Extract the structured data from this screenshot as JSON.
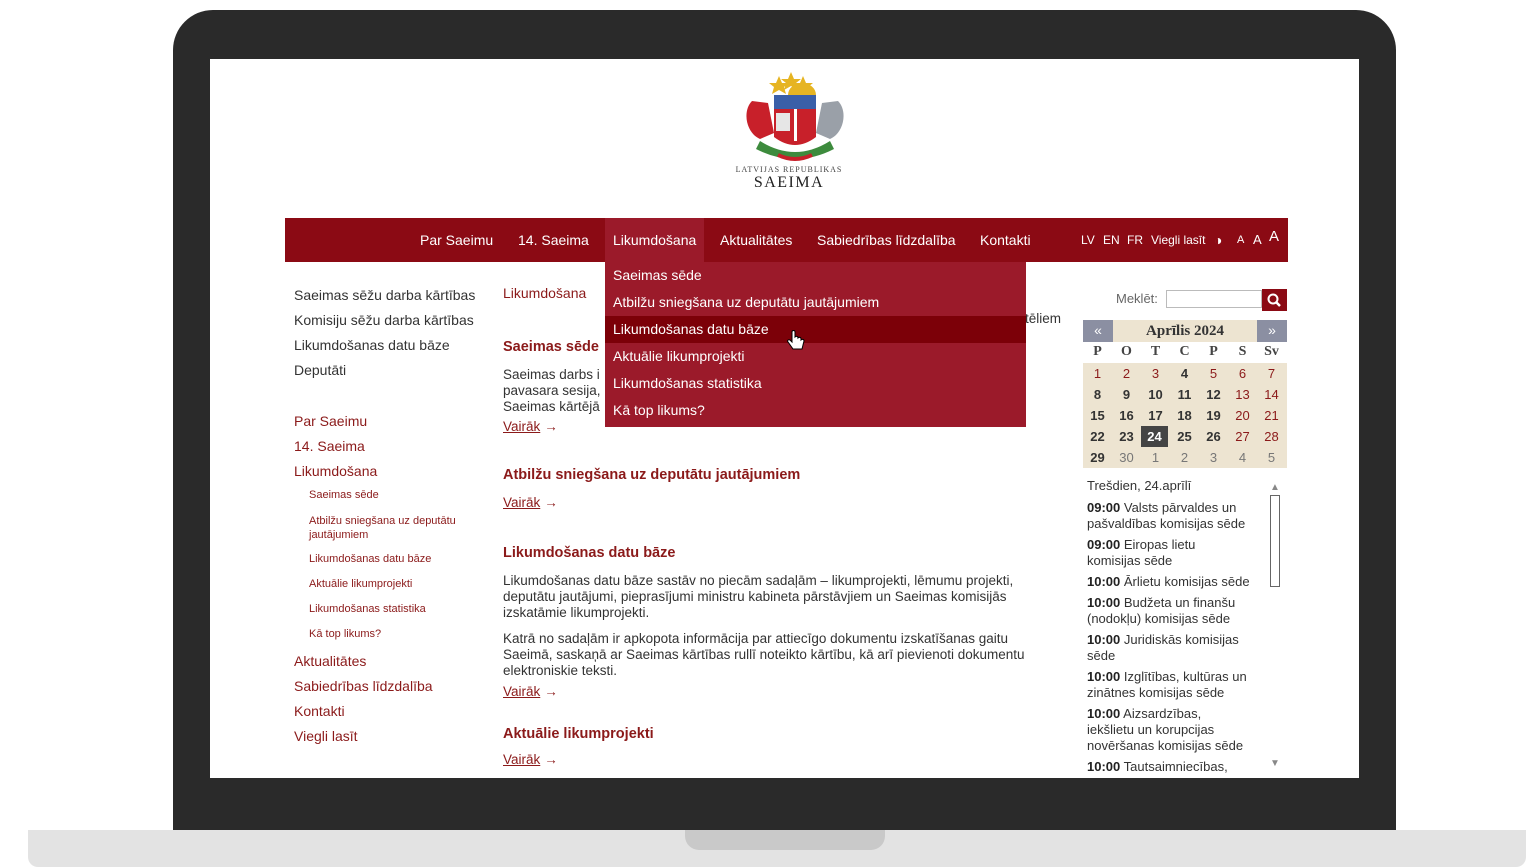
{
  "logo": {
    "line1": "LATVIJAS REPUBLIKAS",
    "line2": "SAEIMA"
  },
  "nav": {
    "items": [
      "Par Saeimu",
      "14. Saeima",
      "Likumdošana",
      "Aktualitātes",
      "Sabiedrības līdzdalība",
      "Kontakti"
    ],
    "active": "Likumdošana",
    "utils": [
      "LV",
      "EN",
      "FR",
      "Viegli lasīt"
    ],
    "font_sizes": [
      "A",
      "A",
      "A"
    ]
  },
  "dropdown": {
    "items": [
      "Saeimas sēde",
      "Atbilžu sniegšana uz deputātu jautājumiem",
      "Likumdošanas datu bāze",
      "Aktuālie likumprojekti",
      "Likumdošanas statistika",
      "Kā top likums?"
    ],
    "hovered": "Likumdošanas datu bāze"
  },
  "sidebar": {
    "quick": [
      "Saeimas sēžu darba kārtības",
      "Komisiju sēžu darba kārtības",
      "Likumdošanas datu bāze",
      "Deputāti"
    ],
    "menu": [
      "Par Saeimu",
      "14. Saeima",
      "Likumdošana"
    ],
    "submenu": [
      "Saeimas sēde",
      "Atbilžu sniegšana uz deputātu jautājumiem",
      "Likumdošanas datu bāze",
      "Aktuālie likumprojekti",
      "Likumdošanas statistika",
      "Kā top likums?"
    ],
    "menu2": [
      "Aktualitātes",
      "Sabiedrības līdzdalība",
      "Kontakti",
      "Viegli lasīt"
    ]
  },
  "main": {
    "breadcrumb": "Likumdošana",
    "hidden_tail": "tēliem",
    "sections": [
      {
        "title": "Saeimas sēde",
        "lines": [
          "Saeimas darbs i",
          "pavasara sesija,",
          "Saeimas kārtējā"
        ],
        "more": "Vairāk"
      },
      {
        "title": "Atbilžu sniegšana uz deputātu jautājumiem",
        "more": "Vairāk"
      },
      {
        "title": "Likumdošanas datu bāze",
        "p1": [
          "Likumdošanas datu bāze sastāv no piecām sadaļām – likumprojekti, lēmumu projekti,",
          "deputātu jautājumi, pieprasījumi ministru kabineta pārstāvjiem un Saeimas komisijās",
          "izskatāmie likumprojekti."
        ],
        "p2": [
          "Katrā no sadaļām ir apkopota informācija par attiecīgo dokumentu izskatīšanas gaitu",
          "Saeimā, saskaņā ar Saeimas kārtības rullī noteikto kārtību, kā arī pievienoti dokumentu",
          "elektroniskie teksti."
        ],
        "more": "Vairāk"
      },
      {
        "title": "Aktuālie likumprojekti",
        "more": "Vairāk"
      }
    ]
  },
  "search": {
    "label": "Meklēt:",
    "value": ""
  },
  "calendar": {
    "prev": "«",
    "next": "»",
    "month": "Aprīlis 2024",
    "dow": [
      "P",
      "O",
      "T",
      "C",
      "P",
      "S",
      "Sv"
    ],
    "weeks": [
      [
        "1",
        "2",
        "3",
        "4",
        "5",
        "6",
        "7"
      ],
      [
        "8",
        "9",
        "10",
        "11",
        "12",
        "13",
        "14"
      ],
      [
        "15",
        "16",
        "17",
        "18",
        "19",
        "20",
        "21"
      ],
      [
        "22",
        "23",
        "24",
        "25",
        "26",
        "27",
        "28"
      ],
      [
        "29",
        "30",
        "1",
        "2",
        "3",
        "4",
        "5"
      ]
    ],
    "today": "24"
  },
  "events": {
    "date": "Trešdien, 24.aprīlī",
    "list": [
      {
        "time": "09:00",
        "lines": [
          "Valsts pārvaldes un",
          "pašvaldības komisijas sēde"
        ]
      },
      {
        "time": "09:00",
        "lines": [
          "Eiropas lietu",
          "komisijas sēde"
        ]
      },
      {
        "time": "10:00",
        "lines": [
          "Ārlietu komisijas sēde"
        ]
      },
      {
        "time": "10:00",
        "lines": [
          "Budžeta un finanšu",
          "(nodokļu) komisijas sēde"
        ]
      },
      {
        "time": "10:00",
        "lines": [
          "Juridiskās komisijas",
          "sēde"
        ]
      },
      {
        "time": "10:00",
        "lines": [
          "Izglītības, kultūras un",
          "zinātnes komisijas sēde"
        ]
      },
      {
        "time": "10:00",
        "lines": [
          "Aizsardzības,",
          "iekšlietu un korupcijas",
          "novēršanas komisijas sēde"
        ]
      },
      {
        "time": "10:00",
        "lines": [
          "Tautsaimniecības,"
        ]
      }
    ]
  },
  "colors": {
    "brand": "#8b0a14",
    "dropdown": "#9b1a2a",
    "hover": "#7c0008",
    "calendar_bg": "#ede4d1"
  }
}
